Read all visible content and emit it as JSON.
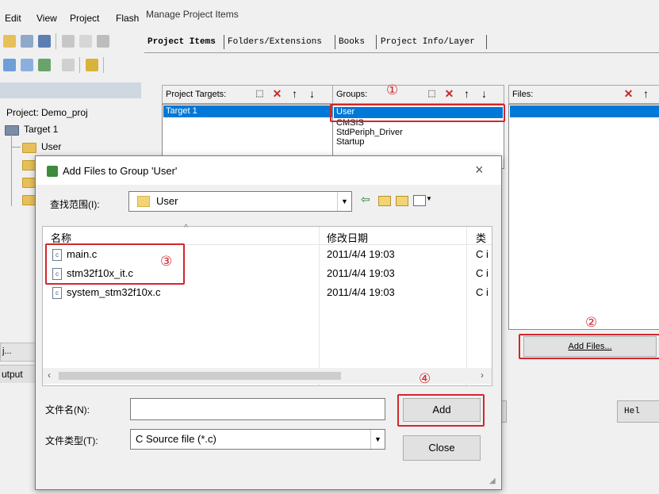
{
  "ide": {
    "menu": [
      "Edit",
      "View",
      "Project",
      "Flash"
    ],
    "project_label": "Project: Demo_proj",
    "target": "Target 1",
    "group": "User",
    "bottom_tab": "j...",
    "output_label": "utput"
  },
  "manage": {
    "window_title": "Manage Project Items",
    "tabs": [
      "Project Items",
      "Folders/Extensions",
      "Books",
      "Project Info/Layer"
    ],
    "targets_label": "Project Targets:",
    "targets": [
      "Target 1"
    ],
    "groups_label": "Groups:",
    "groups": [
      "User",
      "CMSIS",
      "StdPeriph_Driver",
      "Startup"
    ],
    "files_label": "Files:",
    "add_files_label": "Add Files...",
    "help_label": "Hel",
    "markers": [
      "①",
      "②",
      "③",
      "④"
    ]
  },
  "dialog": {
    "title": "Add Files to Group 'User'",
    "close_glyph": "×",
    "lookin_label": "查找范围(I):",
    "lookin_value": "User",
    "col_name": "名称",
    "col_date": "修改日期",
    "col_type": "类",
    "files": [
      {
        "name": "main.c",
        "date": "2011/4/4 19:03",
        "type": "C i"
      },
      {
        "name": "stm32f10x_it.c",
        "date": "2011/4/4 19:03",
        "type": "C i"
      },
      {
        "name": "system_stm32f10x.c",
        "date": "2011/4/4 19:03",
        "type": "C i"
      }
    ],
    "filename_label": "文件名(N):",
    "filename_value": "",
    "filetype_label": "文件类型(T):",
    "filetype_value": "C Source file (*.c)",
    "add_label": "Add",
    "close_label": "Close"
  },
  "colors": {
    "highlight": "#0078d7",
    "marker": "#d3262c"
  }
}
